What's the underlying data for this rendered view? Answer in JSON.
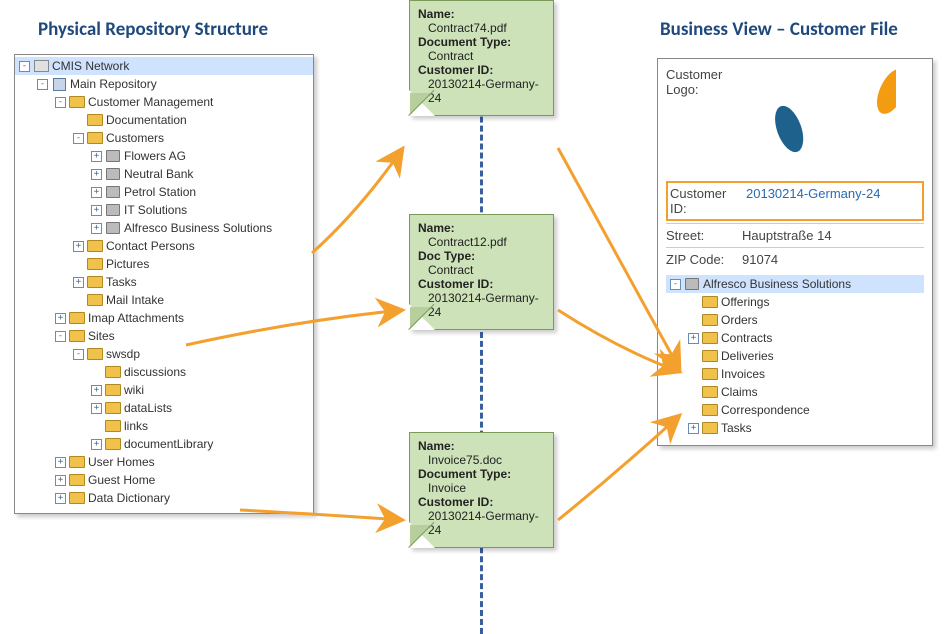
{
  "titles": {
    "left": "Physical Repository Structure",
    "right": "Business View – Customer File"
  },
  "tree": {
    "root": "CMIS Network",
    "repo": "Main Repository",
    "nodes": {
      "custMgmt": "Customer Management",
      "documentation": "Documentation",
      "customers": "Customers",
      "flowers": "Flowers AG",
      "neutral": "Neutral Bank",
      "petrol": "Petrol Station",
      "itsol": "IT Solutions",
      "alfresco": "Alfresco Business Solutions",
      "contactPersons": "Contact Persons",
      "pictures": "Pictures",
      "tasks": "Tasks",
      "mailIntake": "Mail Intake",
      "imap": "Imap Attachments",
      "sites": "Sites",
      "swsdp": "swsdp",
      "discussions": "discussions",
      "wiki": "wiki",
      "dataLists": "dataLists",
      "links": "links",
      "docLib": "documentLibrary",
      "userHomes": "User Homes",
      "guestHome": "Guest Home",
      "dataDict": "Data Dictionary"
    }
  },
  "docs": [
    {
      "fields": [
        {
          "k": "Name:",
          "v": "Contract74.pdf"
        },
        {
          "k": "Document Type:",
          "v": "Contract"
        },
        {
          "k": "Customer ID:",
          "v": "20130214-Germany-24"
        }
      ]
    },
    {
      "fields": [
        {
          "k": "Name:",
          "v": "Contract12.pdf"
        },
        {
          "k": "Doc Type:",
          "v": "Contract"
        },
        {
          "k": "Customer ID:",
          "v": "20130214-Germany-24"
        }
      ]
    },
    {
      "fields": [
        {
          "k": "Name:",
          "v": "Invoice75.doc"
        },
        {
          "k": "Document Type:",
          "v": "Invoice"
        },
        {
          "k": "Customer ID:",
          "v": "20130214-Germany-24"
        }
      ]
    }
  ],
  "business": {
    "logoLabel": "Customer Logo:",
    "customerIdLabel": "Customer ID:",
    "customerId": "20130214-Germany-24",
    "streetLabel": "Street:",
    "street": "Hauptstraße 14",
    "zipLabel": "ZIP Code:",
    "zip": "91074",
    "root": "Alfresco Business Solutions",
    "folders": {
      "offerings": "Offerings",
      "orders": "Orders",
      "contracts": "Contracts",
      "deliveries": "Deliveries",
      "invoices": "Invoices",
      "claims": "Claims",
      "correspondence": "Correspondence",
      "tasks": "Tasks"
    }
  }
}
